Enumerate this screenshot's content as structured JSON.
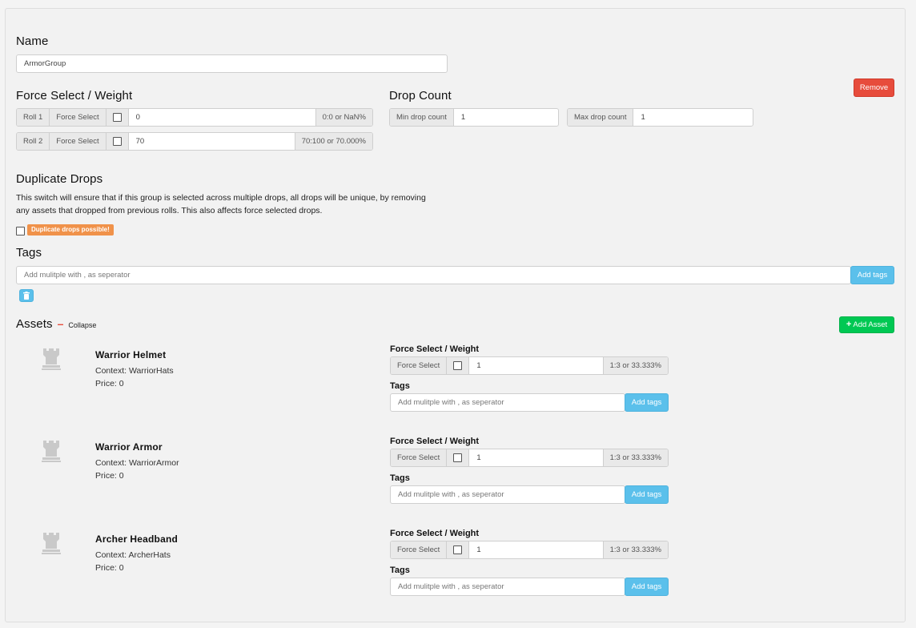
{
  "name_section": {
    "heading": "Name",
    "value": "ArmorGroup"
  },
  "remove_label": "Remove",
  "force_select": {
    "heading": "Force Select / Weight",
    "rows": [
      {
        "roll": "Roll 1",
        "force_label": "Force Select",
        "value": "0",
        "chance": "0:0 or NaN%"
      },
      {
        "roll": "Roll 2",
        "force_label": "Force Select",
        "value": "70",
        "chance": "70:100 or 70.000%"
      }
    ]
  },
  "drop_count": {
    "heading": "Drop Count",
    "min_label": "Min drop count",
    "min_value": "1",
    "max_label": "Max drop count",
    "max_value": "1"
  },
  "duplicate": {
    "heading": "Duplicate Drops",
    "description_line1": "This switch will ensure that if this group is selected across multiple drops, all drops will be unique, by removing",
    "description_line2": "any assets that dropped from previous rolls. This also affects force selected drops.",
    "badge": "Duplicate drops possible!"
  },
  "tags": {
    "heading": "Tags",
    "placeholder": "Add mulitple with , as seperator",
    "add_label": "Add tags"
  },
  "assets": {
    "heading": "Assets",
    "dash": "–",
    "collapse_label": "Collapse",
    "add_label": "Add Asset",
    "items": [
      {
        "name": "Warrior Helmet",
        "context": "Context: WarriorHats",
        "price": "Price: 0",
        "fs_heading": "Force Select / Weight",
        "force_label": "Force Select",
        "weight": "1",
        "chance": "1:3 or 33.333%",
        "tags_heading": "Tags",
        "tags_placeholder": "Add mulitple with , as seperator",
        "add_tags_label": "Add tags"
      },
      {
        "name": "Warrior Armor",
        "context": "Context: WarriorArmor",
        "price": "Price: 0",
        "fs_heading": "Force Select / Weight",
        "force_label": "Force Select",
        "weight": "1",
        "chance": "1:3 or 33.333%",
        "tags_heading": "Tags",
        "tags_placeholder": "Add mulitple with , as seperator",
        "add_tags_label": "Add tags"
      },
      {
        "name": "Archer Headband",
        "context": "Context: ArcherHats",
        "price": "Price: 0",
        "fs_heading": "Force Select / Weight",
        "force_label": "Force Select",
        "weight": "1",
        "chance": "1:3 or 33.333%",
        "tags_heading": "Tags",
        "tags_placeholder": "Add mulitple with , as seperator",
        "add_tags_label": "Add tags"
      }
    ]
  },
  "colors": {
    "remove": "#e74c3c",
    "add_tags": "#5bc0eb",
    "add_asset": "#00c853",
    "badge": "#f0924a"
  }
}
